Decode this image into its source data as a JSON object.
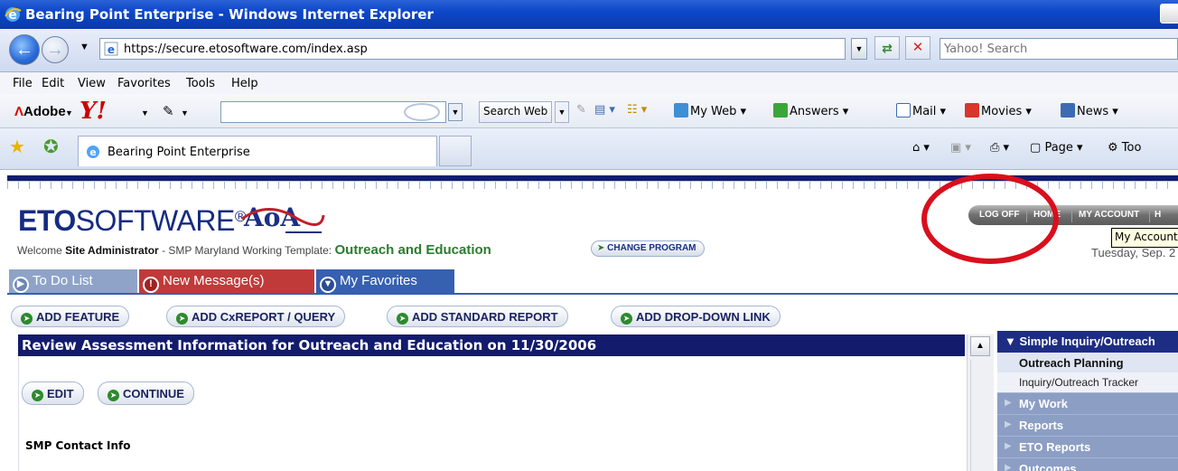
{
  "window": {
    "title": "Bearing Point Enterprise - Windows Internet Explorer"
  },
  "addressbar": {
    "url": "https://secure.etosoftware.com/index.asp",
    "search_placeholder": "Yahoo! Search"
  },
  "menu": [
    "File",
    "Edit",
    "View",
    "Favorites",
    "Tools",
    "Help"
  ],
  "yahoo_toolbar": {
    "adobe": "Adobe",
    "search_web": "Search Web",
    "items": [
      "My Web",
      "Answers",
      "Mail",
      "Movies",
      "News"
    ]
  },
  "tabs": {
    "active": "Bearing Point Enterprise",
    "commands": [
      "Page",
      "Too"
    ]
  },
  "app": {
    "logo_bold": "ETO",
    "logo_rest": "SOFTWARE",
    "logo_reg": "®",
    "partner_logo": "AoA",
    "welcome_prefix": "Welcome",
    "user": "Site Administrator",
    "template": "- SMP Maryland Working Template:",
    "program": "Outreach and Education",
    "change_program": "CHANGE PROGRAM",
    "nav": [
      "LOG OFF",
      "HOME",
      "MY ACCOUNT",
      "H"
    ],
    "tooltip": "My Account",
    "date": "Tuesday, Sep. 2",
    "tabs": [
      "To Do List",
      "New Message(s)",
      "My Favorites"
    ],
    "add_buttons": [
      "ADD FEATURE",
      "ADD CxREPORT / QUERY",
      "ADD STANDARD REPORT",
      "ADD DROP-DOWN LINK"
    ],
    "review_title": "Review Assessment Information for Outreach and Education on 11/30/2006",
    "edit": "EDIT",
    "continue": "CONTINUE",
    "section": "SMP Contact Info"
  },
  "sidebar": {
    "header": "Simple Inquiry/Outreach",
    "selected": "Outreach Planning",
    "sub": "Inquiry/Outreach Tracker",
    "items": [
      "My Work",
      "Reports",
      "ETO Reports",
      "Outcomes"
    ]
  },
  "colors": {
    "titlebar": "#0d47c9",
    "navy": "#131b6c",
    "highlight_circle": "#d90f1d",
    "program_green": "#2b7c2e"
  }
}
